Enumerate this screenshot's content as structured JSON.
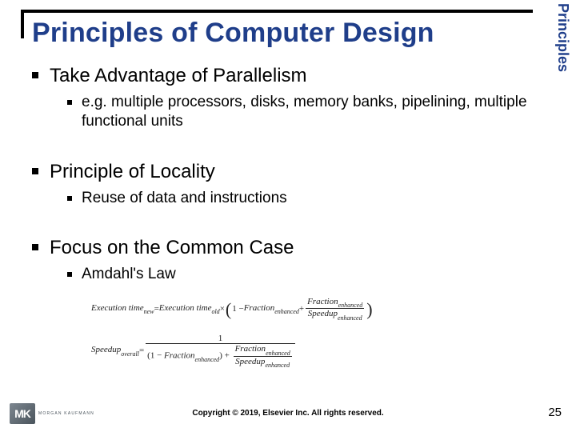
{
  "title": "Principles of Computer Design",
  "side_label": "Principles",
  "bullets": [
    {
      "text": "Take Advantage of Parallelism",
      "sub": [
        {
          "text": "e.g. multiple processors, disks, memory banks, pipelining, multiple functional units"
        }
      ]
    },
    {
      "text": "Principle of Locality",
      "sub": [
        {
          "text": "Reuse of data and instructions"
        }
      ]
    },
    {
      "text": "Focus on the Common Case",
      "sub": [
        {
          "text": "Amdahl's Law"
        }
      ]
    }
  ],
  "formulas": {
    "eq1": {
      "lhs_base": "Execution time",
      "lhs_sub": "new",
      "old_base": "Execution time",
      "old_sub": "old",
      "one_minus": "1 − ",
      "fe_base": "Fraction",
      "fe_sub": "enhanced",
      "plus": " + ",
      "frac_num_base": "Fraction",
      "frac_num_sub": "enhanced",
      "frac_den_base": "Speedup",
      "frac_den_sub": "enhanced",
      "eq": " = ",
      "times": " × "
    },
    "eq2": {
      "lhs_base": "Speedup",
      "lhs_sub": "overall",
      "eq": " = ",
      "num": "1",
      "den_left_pre": "(1 − ",
      "den_fe_base": "Fraction",
      "den_fe_sub": "enhanced",
      "den_left_post": ") + ",
      "den_frac_num_base": "Fraction",
      "den_frac_num_sub": "enhanced",
      "den_frac_den_base": "Speedup",
      "den_frac_den_sub": "enhanced"
    }
  },
  "footer": {
    "logo_text": "MK",
    "logo_caption": "MORGAN KAUFMANN",
    "copyright": "Copyright © 2019, Elsevier Inc. All rights reserved.",
    "page": "25"
  }
}
